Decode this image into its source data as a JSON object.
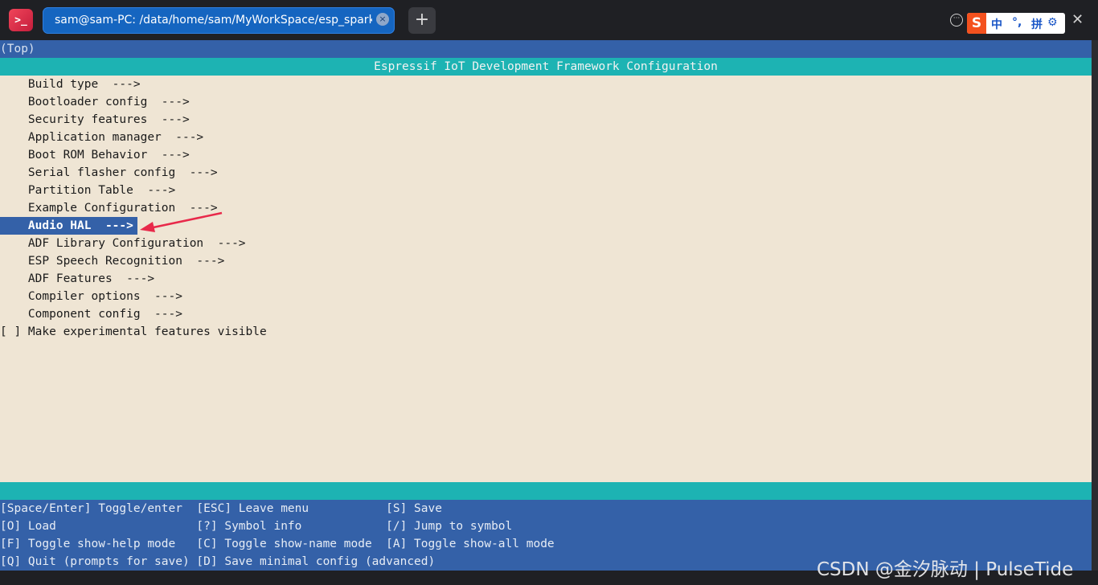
{
  "window": {
    "tab_title": "sam@sam-PC: /data/home/sam/MyWorkSpace/esp_sparkbo··",
    "tab_close": "×",
    "new_tab": "+",
    "more": "···",
    "close": "✕",
    "app_icon": ">_"
  },
  "ime": {
    "logo": "S",
    "items": [
      "中",
      "°,",
      "拼",
      "⚙"
    ]
  },
  "terminal": {
    "breadcrumb": "(Top)",
    "header": "Espressif IoT Development Framework Configuration",
    "menu": [
      "    Build type  --->",
      "    Bootloader config  --->",
      "    Security features  --->",
      "    Application manager  --->",
      "    Boot ROM Behavior  --->",
      "    Serial flasher config  --->",
      "    Partition Table  --->",
      "    Example Configuration  --->",
      "    Audio HAL  --->",
      "    ADF Library Configuration  --->",
      "    ESP Speech Recognition  --->",
      "    ADF Features  --->",
      "    Compiler options  --->",
      "    Component config  --->",
      "[ ] Make experimental features visible"
    ],
    "selected_index": 8,
    "help": [
      "[Space/Enter] Toggle/enter  [ESC] Leave menu           [S] Save",
      "[O] Load                    [?] Symbol info            [/] Jump to symbol",
      "[F] Toggle show-help mode   [C] Toggle show-name mode  [A] Toggle show-all mode",
      "[Q] Quit (prompts for save) [D] Save minimal config (advanced)"
    ]
  },
  "watermark": "CSDN @金汐脉动 | PulseTide",
  "colors": {
    "terminal_bg": "#efe5d4",
    "bar_blue": "#3461a8",
    "bar_teal": "#1db3b3",
    "annotation_arrow": "#e8294a"
  }
}
